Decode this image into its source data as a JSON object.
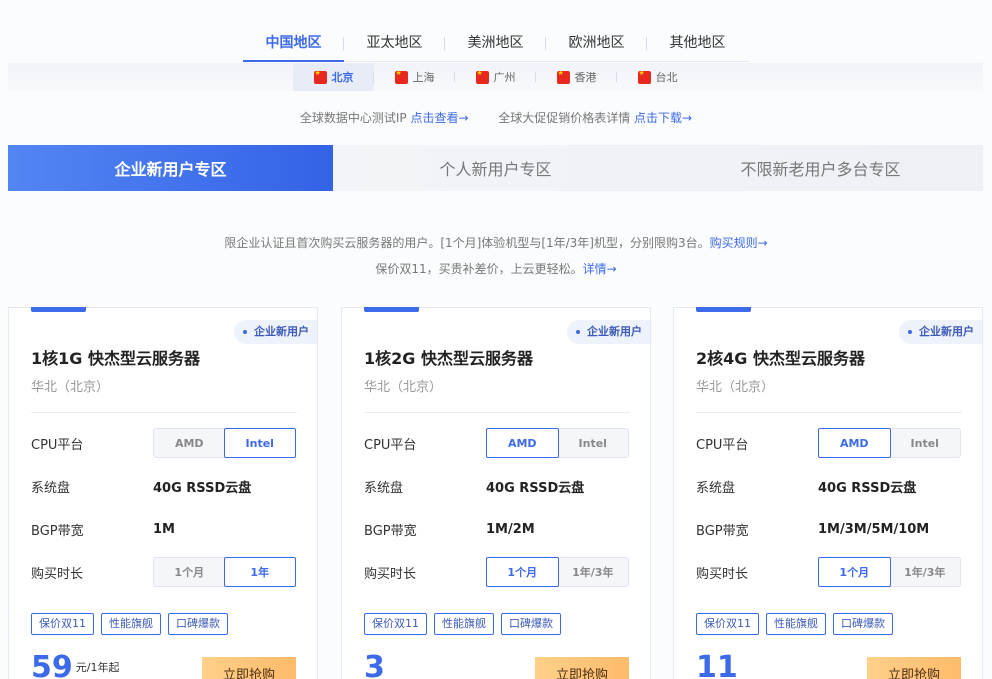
{
  "region_tabs": [
    "中国地区",
    "亚太地区",
    "美洲地区",
    "欧洲地区",
    "其他地区"
  ],
  "cities": [
    "北京",
    "上海",
    "广州",
    "香港",
    "台北"
  ],
  "info": {
    "test_ip_text": "全球数据中心测试IP",
    "test_ip_link": "点击查看→",
    "price_list_text": "全球大促促销价格表详情",
    "price_list_link": "点击下载→"
  },
  "zone_tabs": [
    "企业新用户专区",
    "个人新用户专区",
    "不限新老用户多台专区"
  ],
  "notes": {
    "line1": "限企业认证且首次购买云服务器的用户。[1个月]体验机型与[1年/3年]机型，分别限购3台。",
    "line1_link": "购买规则→",
    "line2": "保价双11，买贵补差价，上云更轻松。",
    "line2_link": "详情→"
  },
  "labels": {
    "cpu": "CPU平台",
    "disk": "系统盘",
    "bandwidth": "BGP带宽",
    "duration": "购买时长",
    "badge": "企业新用户",
    "buy": "立即抢购"
  },
  "cards": [
    {
      "title": "1核1G 快杰型云服务器",
      "region": "华北（北京）",
      "cpu_options": [
        "AMD",
        "Intel"
      ],
      "disk": "40G RSSD云盘",
      "bandwidth": "1M",
      "duration_options": [
        "1个月",
        "1年"
      ],
      "tags": [
        "保价双11",
        "性能旗舰",
        "口碑爆款"
      ],
      "price": "59",
      "price_unit": "元/1年起"
    },
    {
      "title": "1核2G 快杰型云服务器",
      "region": "华北（北京）",
      "cpu_options": [
        "AMD",
        "Intel"
      ],
      "disk": "40G RSSD云盘",
      "bandwidth": "1M/2M",
      "duration_options": [
        "1个月",
        "1年/3年"
      ],
      "tags": [
        "保价双11",
        "性能旗舰",
        "口碑爆款"
      ],
      "price": "3",
      "price_unit": ""
    },
    {
      "title": "2核4G 快杰型云服务器",
      "region": "华北（北京）",
      "cpu_options": [
        "AMD",
        "Intel"
      ],
      "disk": "40G RSSD云盘",
      "bandwidth": "1M/3M/5M/10M",
      "duration_options": [
        "1个月",
        "1年/3年"
      ],
      "tags": [
        "保价双11",
        "性能旗舰",
        "口碑爆款"
      ],
      "price": "11",
      "price_unit": ""
    }
  ]
}
